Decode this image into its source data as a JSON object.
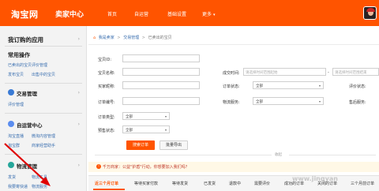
{
  "header": {
    "logo": "淘宝网",
    "logo_sub": "卖家中心",
    "nav": [
      "首页",
      "自运营",
      "基础设置",
      "更多"
    ]
  },
  "sidebar": {
    "title": "我订购的应用",
    "common": {
      "title": "常用操作",
      "links": [
        "已卖出的宝贝",
        "评价管理",
        "发布宝贝",
        "出售中的宝贝"
      ]
    },
    "trade": {
      "title": "交易管理",
      "links": [
        "评价管理"
      ]
    },
    "self": {
      "title": "自运营中心",
      "links": [
        "淘宝直播",
        "微淘内容管理",
        "淘宝群",
        "商家经营助手"
      ]
    },
    "logistics": {
      "title": "物流管理",
      "links": [
        "发货",
        "物流工具",
        "我要寄快递",
        "物流服务"
      ]
    }
  },
  "breadcrumb": [
    "我是卖家",
    "交易管理",
    "已卖出的宝贝"
  ],
  "form": {
    "item_id": "宝贝ID:",
    "item_name": "宝贝名称:",
    "buyer_nick": "买家昵称:",
    "order_no": "订单编号:",
    "order_type": "订单类型:",
    "presale": "预售状态:",
    "deal_time": "成交时间:",
    "deal_from_placeholder": "请选择时间范围起始",
    "deal_to_placeholder": "请选择时间范围结束",
    "deal_sep": "-",
    "order_status": "订单状态:",
    "review_status": "评价状态:",
    "logistics_service": "物流服务:",
    "aftersale": "售后服务:",
    "all": "全部",
    "search_btn": "搜索订单",
    "export_btn": "批量导出",
    "collapse": "收起"
  },
  "notice": {
    "icon": "!",
    "text": "千万商家：公益\"护盾\"行动，你想要加入我们吗？"
  },
  "tabs": [
    "近三个月订单",
    "等待买家付款",
    "等待发货",
    "已发货",
    "退款中",
    "需要评价",
    "成功的订单",
    "关闭的订单",
    "三个月前订单"
  ],
  "watermark": "www.jingyan",
  "colors": {
    "brand": "#ff5400",
    "link": "#3a6fb0",
    "arrow": "#e00000"
  }
}
